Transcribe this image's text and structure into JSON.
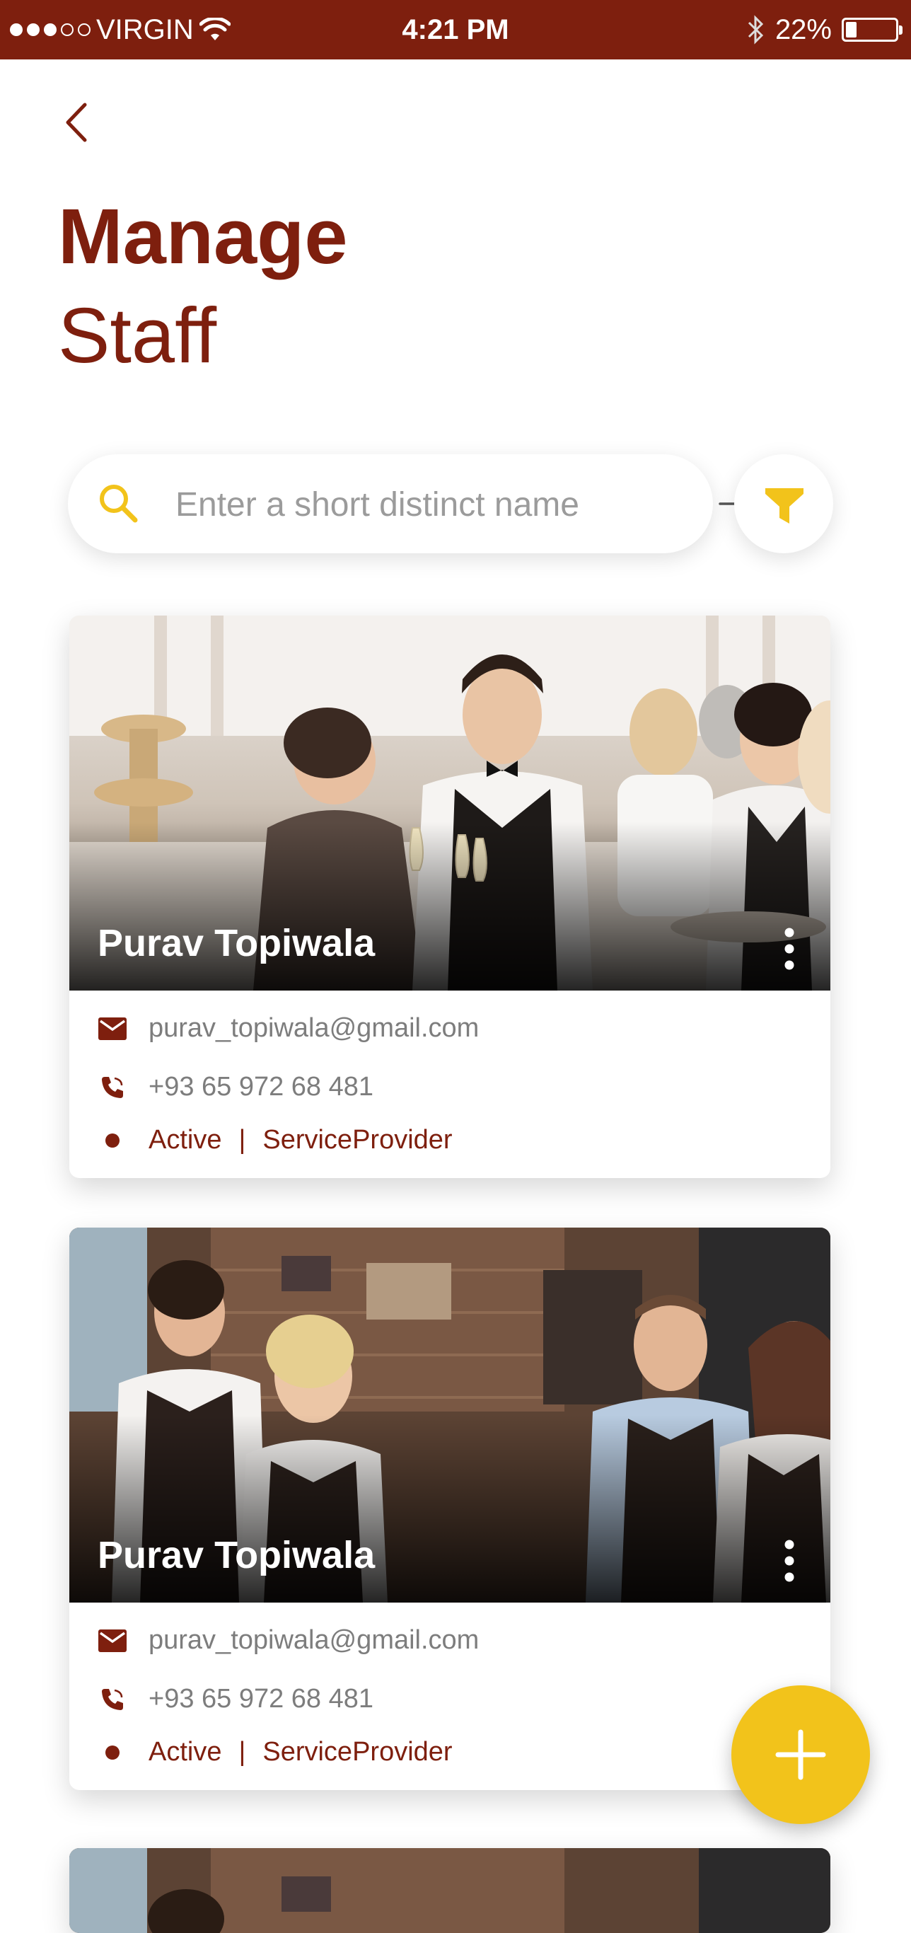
{
  "status_bar": {
    "carrier": "VIRGIN",
    "time": "4:21 PM",
    "battery_text": "22%",
    "battery_level": 0.22
  },
  "header": {
    "title_line1": "Manage",
    "title_line2": "Staff"
  },
  "search": {
    "placeholder": "Enter a short distinct name",
    "value": ""
  },
  "colors": {
    "primary": "#7e1f0e",
    "accent": "#f2c31b"
  },
  "staff": [
    {
      "name": "Purav Topiwala",
      "email": "purav_topiwala@gmail.com",
      "phone": "+93 65 972 68 481",
      "status": "Active",
      "separator": "|",
      "role": "ServiceProvider"
    },
    {
      "name": "Purav Topiwala",
      "email": "purav_topiwala@gmail.com",
      "phone": "+93 65 972 68 481",
      "status": "Active",
      "separator": "|",
      "role": "ServiceProvider"
    }
  ],
  "icons": {
    "back": "chevron-left-icon",
    "search": "search-icon",
    "go": "arrow-right-icon",
    "filter": "filter-icon",
    "more": "more-vertical-icon",
    "email": "mail-icon",
    "phone": "phone-icon",
    "add": "plus-icon"
  }
}
